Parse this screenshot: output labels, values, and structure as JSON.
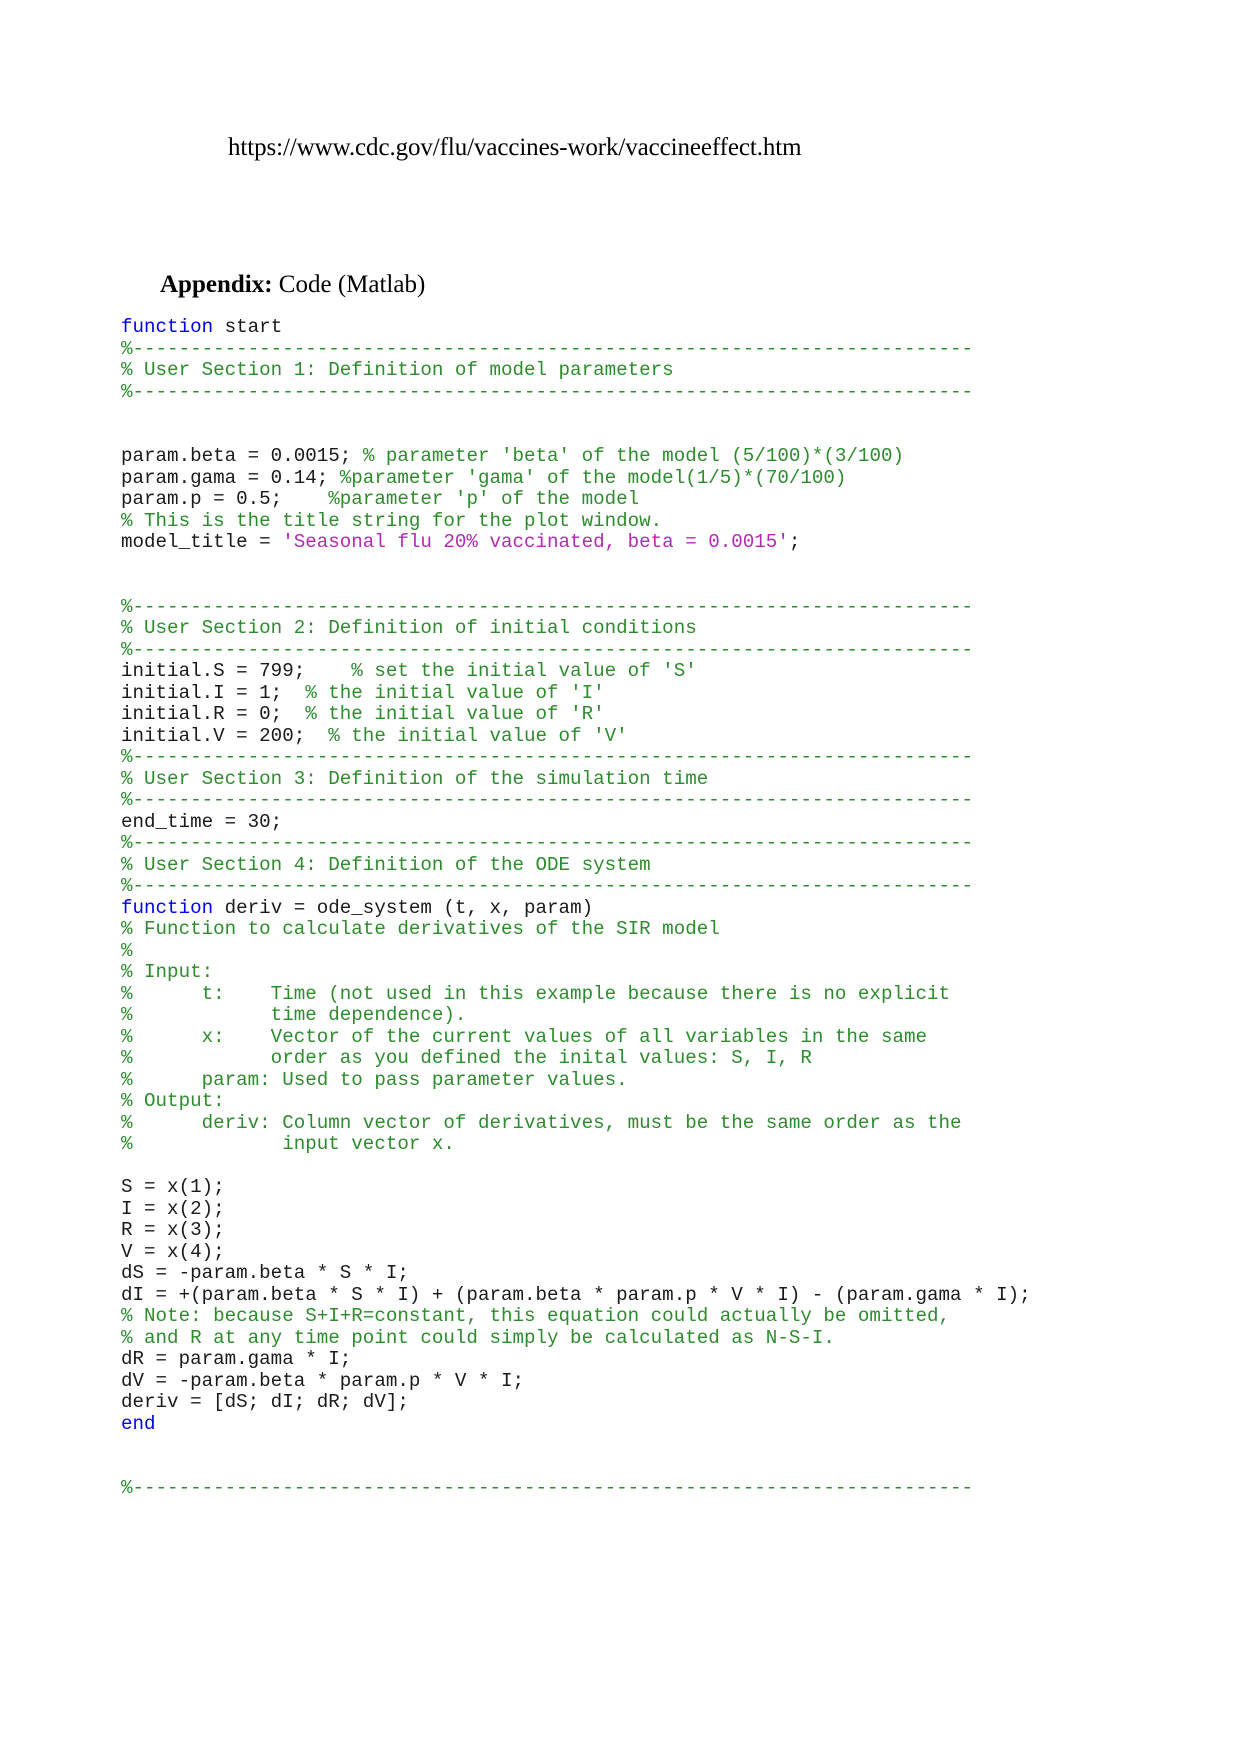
{
  "document": {
    "header_url": "https://www.cdc.gov/flu/vaccines-work/vaccineeffect.htm",
    "appendix_label": "Appendix:",
    "appendix_title": " Code (Matlab)",
    "colors": {
      "keyword": "#0000f0",
      "comment": "#2e8b2e",
      "string": "#b429b4",
      "plain": "#1a1a1a",
      "background": "#ffffff"
    }
  },
  "code": {
    "language": "Matlab",
    "lines": [
      {
        "segments": [
          {
            "t": "function",
            "c": "kw"
          },
          {
            "t": " start",
            "c": "plain"
          }
        ]
      },
      {
        "segments": [
          {
            "t": "%-------------------------------------------------------------------------",
            "c": "cmt"
          }
        ]
      },
      {
        "segments": [
          {
            "t": "% User Section 1: Definition of model parameters",
            "c": "cmt"
          }
        ]
      },
      {
        "segments": [
          {
            "t": "%-------------------------------------------------------------------------",
            "c": "cmt"
          }
        ]
      },
      {
        "segments": [
          {
            "t": "",
            "c": "plain"
          }
        ]
      },
      {
        "segments": [
          {
            "t": "",
            "c": "plain"
          }
        ]
      },
      {
        "segments": [
          {
            "t": "param.beta = 0.0015; ",
            "c": "plain"
          },
          {
            "t": "% parameter 'beta' of the model (5/100)*(3/100)",
            "c": "cmt"
          }
        ]
      },
      {
        "segments": [
          {
            "t": "param.gama = 0.14; ",
            "c": "plain"
          },
          {
            "t": "%parameter 'gama' of the model(1/5)*(70/100)",
            "c": "cmt"
          }
        ]
      },
      {
        "segments": [
          {
            "t": "param.p = 0.5;    ",
            "c": "plain"
          },
          {
            "t": "%parameter 'p' of the model",
            "c": "cmt"
          }
        ]
      },
      {
        "segments": [
          {
            "t": "% This is the title string for the plot window.",
            "c": "cmt"
          }
        ]
      },
      {
        "segments": [
          {
            "t": "model_title = ",
            "c": "plain"
          },
          {
            "t": "'Seasonal flu 20% vaccinated, beta = 0.0015'",
            "c": "str"
          },
          {
            "t": ";",
            "c": "plain"
          }
        ]
      },
      {
        "segments": [
          {
            "t": "",
            "c": "plain"
          }
        ]
      },
      {
        "segments": [
          {
            "t": "",
            "c": "plain"
          }
        ]
      },
      {
        "segments": [
          {
            "t": "%-------------------------------------------------------------------------",
            "c": "cmt"
          }
        ]
      },
      {
        "segments": [
          {
            "t": "% User Section 2: Definition of initial conditions",
            "c": "cmt"
          }
        ]
      },
      {
        "segments": [
          {
            "t": "%-------------------------------------------------------------------------",
            "c": "cmt"
          }
        ]
      },
      {
        "segments": [
          {
            "t": "initial.S = 799;    ",
            "c": "plain"
          },
          {
            "t": "% set the initial value of 'S'",
            "c": "cmt"
          }
        ]
      },
      {
        "segments": [
          {
            "t": "initial.I = 1;  ",
            "c": "plain"
          },
          {
            "t": "% the initial value of 'I'",
            "c": "cmt"
          }
        ]
      },
      {
        "segments": [
          {
            "t": "initial.R = 0;  ",
            "c": "plain"
          },
          {
            "t": "% the initial value of 'R'",
            "c": "cmt"
          }
        ]
      },
      {
        "segments": [
          {
            "t": "initial.V = 200;  ",
            "c": "plain"
          },
          {
            "t": "% the initial value of 'V'",
            "c": "cmt"
          }
        ]
      },
      {
        "segments": [
          {
            "t": "%-------------------------------------------------------------------------",
            "c": "cmt"
          }
        ]
      },
      {
        "segments": [
          {
            "t": "% User Section 3: Definition of the simulation time",
            "c": "cmt"
          }
        ]
      },
      {
        "segments": [
          {
            "t": "%-------------------------------------------------------------------------",
            "c": "cmt"
          }
        ]
      },
      {
        "segments": [
          {
            "t": "end_time = 30;",
            "c": "plain"
          }
        ]
      },
      {
        "segments": [
          {
            "t": "%-------------------------------------------------------------------------",
            "c": "cmt"
          }
        ]
      },
      {
        "segments": [
          {
            "t": "% User Section 4: Definition of the ODE system",
            "c": "cmt"
          }
        ]
      },
      {
        "segments": [
          {
            "t": "%-------------------------------------------------------------------------",
            "c": "cmt"
          }
        ]
      },
      {
        "segments": [
          {
            "t": "function",
            "c": "kw"
          },
          {
            "t": " deriv = ode_system (t, x, param)",
            "c": "plain"
          }
        ]
      },
      {
        "segments": [
          {
            "t": "% Function to calculate derivatives of the SIR model",
            "c": "cmt"
          }
        ]
      },
      {
        "segments": [
          {
            "t": "%",
            "c": "cmt"
          }
        ]
      },
      {
        "segments": [
          {
            "t": "% Input:",
            "c": "cmt"
          }
        ]
      },
      {
        "segments": [
          {
            "t": "%      t:    Time (not used in this example because there is no explicit",
            "c": "cmt"
          }
        ]
      },
      {
        "segments": [
          {
            "t": "%            time dependence).",
            "c": "cmt"
          }
        ]
      },
      {
        "segments": [
          {
            "t": "%      x:    Vector of the current values of all variables in the same",
            "c": "cmt"
          }
        ]
      },
      {
        "segments": [
          {
            "t": "%            order as you defined the inital values: S, I, R",
            "c": "cmt"
          }
        ]
      },
      {
        "segments": [
          {
            "t": "%      param: Used to pass parameter values.",
            "c": "cmt"
          }
        ]
      },
      {
        "segments": [
          {
            "t": "% Output:",
            "c": "cmt"
          }
        ]
      },
      {
        "segments": [
          {
            "t": "%      deriv: Column vector of derivatives, must be the same order as the",
            "c": "cmt"
          }
        ]
      },
      {
        "segments": [
          {
            "t": "%             input vector x.",
            "c": "cmt"
          }
        ]
      },
      {
        "segments": [
          {
            "t": "",
            "c": "plain"
          }
        ]
      },
      {
        "segments": [
          {
            "t": "S = x(1);",
            "c": "plain"
          }
        ]
      },
      {
        "segments": [
          {
            "t": "I = x(2);",
            "c": "plain"
          }
        ]
      },
      {
        "segments": [
          {
            "t": "R = x(3);",
            "c": "plain"
          }
        ]
      },
      {
        "segments": [
          {
            "t": "V = x(4);",
            "c": "plain"
          }
        ]
      },
      {
        "segments": [
          {
            "t": "dS = -param.beta * S * I;",
            "c": "plain"
          }
        ]
      },
      {
        "segments": [
          {
            "t": "dI = +(param.beta * S * I) + (param.beta * param.p * V * I) - (param.gama * I);",
            "c": "plain"
          }
        ]
      },
      {
        "segments": [
          {
            "t": "% Note: because S+I+R=constant, this equation could actually be omitted,",
            "c": "cmt"
          }
        ]
      },
      {
        "segments": [
          {
            "t": "% and R at any time point could simply be calculated as N-S-I.",
            "c": "cmt"
          }
        ]
      },
      {
        "segments": [
          {
            "t": "dR = param.gama * I;",
            "c": "plain"
          }
        ]
      },
      {
        "segments": [
          {
            "t": "dV = -param.beta * param.p * V * I;",
            "c": "plain"
          }
        ]
      },
      {
        "segments": [
          {
            "t": "deriv = [dS; dI; dR; dV];",
            "c": "plain"
          }
        ]
      },
      {
        "segments": [
          {
            "t": "end",
            "c": "kw"
          }
        ]
      },
      {
        "segments": [
          {
            "t": "",
            "c": "plain"
          }
        ]
      },
      {
        "segments": [
          {
            "t": "",
            "c": "plain"
          }
        ]
      },
      {
        "segments": [
          {
            "t": "%-------------------------------------------------------------------------",
            "c": "cmt"
          }
        ]
      }
    ]
  }
}
